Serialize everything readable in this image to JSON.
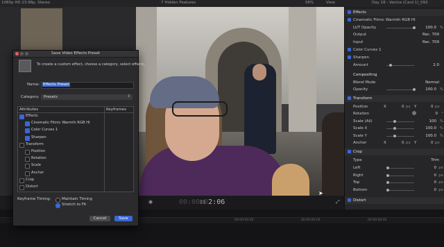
{
  "top_bar": {
    "format": "1080p HD 23.98p, Stereo",
    "hidden_features": "7 Hidden Features",
    "zoom": "56%",
    "view_menu": "View",
    "clip_title": "Day 18 - Venice (Card 1)_093"
  },
  "viewer": {
    "timecode_dim": "00:00:0",
    "timecode": "2:06"
  },
  "timeline": {
    "ruler_marks": [
      "00:00:04:00",
      "00:00:06:00",
      "00:00:08:00"
    ]
  },
  "inspector": {
    "effects_header": "Effects",
    "effect_name": "Cinematic Filmic Warmth RGB HI",
    "lut_opacity_label": "LUT Opacity",
    "lut_opacity_value": "100.0",
    "lut_opacity_unit": "%",
    "output_label": "Output",
    "output_value": "Rec. 709",
    "input_label": "Input",
    "input_value": "Rec. 709",
    "color_curves": "Color Curves 1",
    "sharpen": "Sharpen",
    "amount_label": "Amount",
    "amount_value": "2.0",
    "compositing": "Compositing",
    "blend_mode_label": "Blend Mode",
    "blend_mode_value": "Normal",
    "opacity_label": "Opacity",
    "opacity_value": "100.0",
    "opacity_unit": "%",
    "transform": "Transform",
    "position_label": "Position",
    "position_x": "0",
    "position_x_axis": "X",
    "position_y": "0",
    "position_y_axis": "Y",
    "px": "px",
    "rotation_label": "Rotation",
    "rotation_value": "0",
    "rotation_unit": "°",
    "scale_all_label": "Scale (All)",
    "scale_all_value": "100",
    "scale_x_label": "Scale X",
    "scale_x_value": "100.0",
    "scale_y_label": "Scale Y",
    "scale_y_value": "100.0",
    "anchor_label": "Anchor",
    "anchor_x": "0",
    "anchor_x_axis": "X",
    "anchor_y": "0",
    "anchor_y_axis": "Y",
    "crop": "Crop",
    "type_label": "Type",
    "type_value": "Trim",
    "left_label": "Left",
    "left_value": "0",
    "right_label": "Right",
    "right_value": "0",
    "top_label": "Top",
    "top_value": "0",
    "bottom_label": "Bottom",
    "bottom_value": "0",
    "distort": "Distort"
  },
  "dialog": {
    "title": "Save Video Effects Preset",
    "description": "To create a custom effect, choose a category, select effects,",
    "name_label": "Name:",
    "name_value": "Effects Preset",
    "category_label": "Category:",
    "category_value": "Presets",
    "attributes_header": "Attributes",
    "keyframes_header": "Keyframes",
    "attributes": [
      {
        "label": "Effects",
        "checked": true,
        "indent": 0
      },
      {
        "label": "Cinematic Filmic Warmth RGB HI",
        "checked": true,
        "indent": 1
      },
      {
        "label": "Color Curves 1",
        "checked": true,
        "indent": 1
      },
      {
        "label": "Sharpen",
        "checked": true,
        "indent": 1
      },
      {
        "label": "Transform",
        "checked": false,
        "indent": 0
      },
      {
        "label": "Position",
        "checked": false,
        "indent": 1
      },
      {
        "label": "Rotation",
        "checked": false,
        "indent": 1
      },
      {
        "label": "Scale",
        "checked": false,
        "indent": 1
      },
      {
        "label": "Anchor",
        "checked": false,
        "indent": 1
      },
      {
        "label": "Crop",
        "checked": false,
        "indent": 0
      },
      {
        "label": "Distort",
        "checked": false,
        "indent": 0
      }
    ],
    "keyframe_timing_label": "Keyframe Timing:",
    "maintain_timing": "Maintain Timing",
    "stretch_to_fit": "Stretch to Fit",
    "cancel": "Cancel",
    "save": "Save"
  },
  "colors": {
    "accent": "#3b67d6",
    "panel": "#2b2b2d"
  }
}
